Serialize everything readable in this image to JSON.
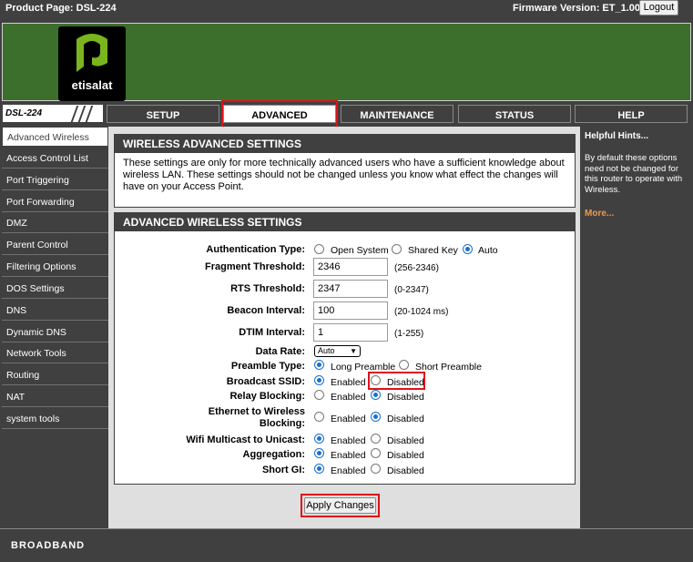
{
  "topbar": {
    "product": "Product Page: DSL-224",
    "firmware": "Firmware Version: ET_1.00",
    "logout": "Logout"
  },
  "brand": {
    "logo_text": "etisalat",
    "model": "DSL-224",
    "colors": {
      "banner": "#3c6e2c",
      "logo_accent": "#7ab51d",
      "highlight": "#e0101a",
      "hints_link": "#f09a4c"
    }
  },
  "tabs": [
    "SETUP",
    "ADVANCED",
    "MAINTENANCE",
    "STATUS",
    "HELP"
  ],
  "active_tab": "ADVANCED",
  "sidebar": {
    "items": [
      "Advanced Wireless",
      "Access Control List",
      "Port Triggering",
      "Port Forwarding",
      "DMZ",
      "Parent Control",
      "Filtering Options",
      "DOS Settings",
      "DNS",
      "Dynamic DNS",
      "Network Tools",
      "Routing",
      "NAT",
      "system tools"
    ]
  },
  "intro": {
    "title": "WIRELESS ADVANCED SETTINGS",
    "text": "These settings are only for more technically advanced users who have a sufficient knowledge about wireless LAN. These settings should not be changed unless you know what effect the changes will have on your Access Point."
  },
  "settings": {
    "title": "ADVANCED WIRELESS SETTINGS",
    "auth": {
      "label": "Authentication Type:",
      "options": [
        "Open System",
        "Shared Key",
        "Auto"
      ],
      "selected": "Auto"
    },
    "fragment": {
      "label": "Fragment Threshold:",
      "value": "2346",
      "hint": "(256-2346)"
    },
    "rts": {
      "label": "RTS Threshold:",
      "value": "2347",
      "hint": "(0-2347)"
    },
    "beacon": {
      "label": "Beacon Interval:",
      "value": "100",
      "hint": "(20-1024 ms)"
    },
    "dtim": {
      "label": "DTIM Interval:",
      "value": "1",
      "hint": "(1-255)"
    },
    "data_rate": {
      "label": "Data Rate:",
      "value": "Auto"
    },
    "preamble": {
      "label": "Preamble Type:",
      "options": [
        "Long Preamble",
        "Short Preamble"
      ],
      "selected": "Long Preamble"
    },
    "broadcast_ssid": {
      "label": "Broadcast SSID:",
      "options": [
        "Enabled",
        "Disabled"
      ],
      "selected": "Enabled"
    },
    "relay_blocking": {
      "label": "Relay Blocking:",
      "options": [
        "Enabled",
        "Disabled"
      ],
      "selected": "Disabled"
    },
    "eth_wireless": {
      "label_line1": "Ethernet to Wireless",
      "label_line2": "Blocking:",
      "options": [
        "Enabled",
        "Disabled"
      ],
      "selected": "Disabled"
    },
    "multicast": {
      "label": "Wifi Multicast to Unicast:",
      "options": [
        "Enabled",
        "Disabled"
      ],
      "selected": "Enabled"
    },
    "aggregation": {
      "label": "Aggregation:",
      "options": [
        "Enabled",
        "Disabled"
      ],
      "selected": "Enabled"
    },
    "short_gi": {
      "label": "Short GI:",
      "options": [
        "Enabled",
        "Disabled"
      ],
      "selected": "Enabled"
    }
  },
  "apply_label": "Apply Changes",
  "hints": {
    "title": "Helpful Hints...",
    "text": "By default these options need not be changed for this router to operate with Wireless.",
    "more": "More..."
  },
  "footer": "BROADBAND"
}
